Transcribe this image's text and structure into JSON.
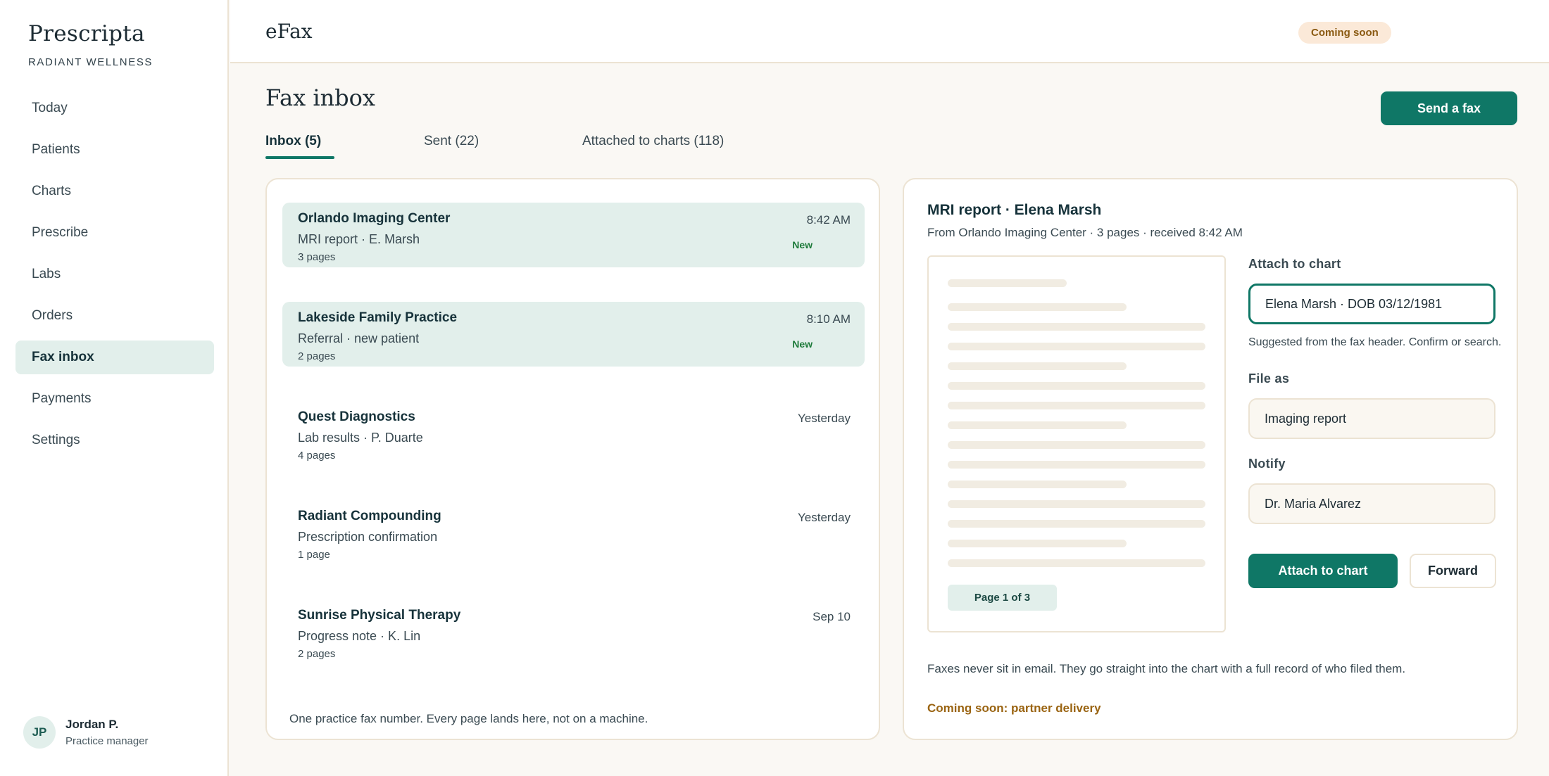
{
  "brand": {
    "name": "Prescripta",
    "subtitle": "RADIANT WELLNESS"
  },
  "sidebar": {
    "items": [
      {
        "label": "Today"
      },
      {
        "label": "Patients"
      },
      {
        "label": "Charts"
      },
      {
        "label": "Prescribe"
      },
      {
        "label": "Labs"
      },
      {
        "label": "Orders"
      },
      {
        "label": "Fax inbox",
        "active": true
      },
      {
        "label": "Payments"
      },
      {
        "label": "Settings"
      }
    ]
  },
  "user": {
    "initials": "JP",
    "name": "Jordan P.",
    "role": "Practice manager"
  },
  "topbar": {
    "title": "eFax",
    "badge": "Coming soon"
  },
  "main": {
    "title": "Fax inbox",
    "send_button": "Send a fax",
    "tabs": [
      {
        "label": "Inbox (5)",
        "active": true
      },
      {
        "label": "Sent (22)"
      },
      {
        "label": "Attached to charts (118)"
      }
    ]
  },
  "inbox": {
    "items": [
      {
        "sender": "Orlando Imaging Center",
        "subject": "MRI report · E. Marsh",
        "pages": "3 pages",
        "time": "8:42 AM",
        "badge": "New"
      },
      {
        "sender": "Lakeside Family Practice",
        "subject": "Referral · new patient",
        "pages": "2 pages",
        "time": "8:10 AM",
        "badge": "New"
      },
      {
        "sender": "Quest Diagnostics",
        "subject": "Lab results · P. Duarte",
        "pages": "4 pages",
        "time": "Yesterday"
      },
      {
        "sender": "Radiant Compounding",
        "subject": "Prescription confirmation",
        "pages": "1 page",
        "time": "Yesterday"
      },
      {
        "sender": "Sunrise Physical Therapy",
        "subject": "Progress note · K. Lin",
        "pages": "2 pages",
        "time": "Sep 10"
      }
    ],
    "footer": "One practice fax number. Every page lands here, not on a machine."
  },
  "detail": {
    "title": "MRI report · Elena Marsh",
    "meta": "From Orlando Imaging Center · 3 pages · received 8:42 AM",
    "page_indicator": "Page 1 of 3",
    "attach_label": "Attach to chart",
    "attach_value": "Elena Marsh · DOB 03/12/1981",
    "attach_hint": "Suggested from the fax header. Confirm or search.",
    "file_as_label": "File as",
    "file_as_value": "Imaging report",
    "notify_label": "Notify",
    "notify_value": "Dr. Maria Alvarez",
    "attach_button": "Attach to chart",
    "forward_button": "Forward",
    "footer": "Faxes never sit in email. They go straight into the chart with a full record of who filed them.",
    "coming_soon": "Coming soon: partner delivery"
  }
}
